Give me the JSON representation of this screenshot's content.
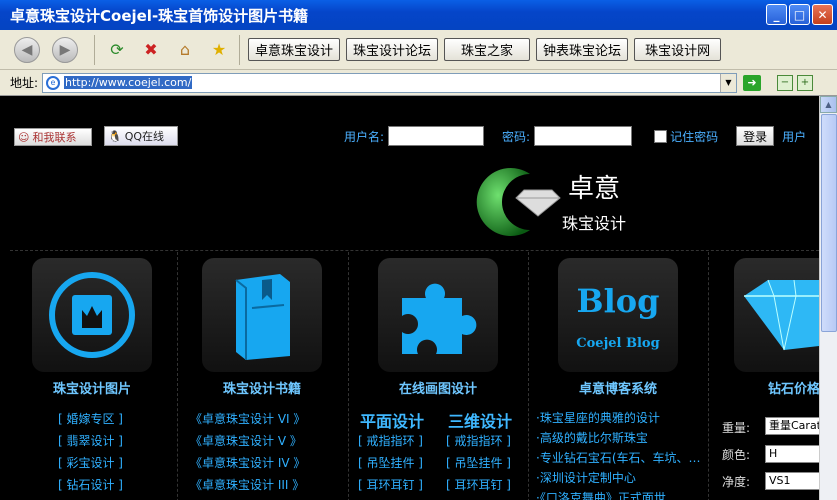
{
  "window": {
    "title": "卓意珠宝设计Coejel-珠宝首饰设计图片书籍"
  },
  "toolbar": {
    "links": [
      "卓意珠宝设计",
      "珠宝设计论坛",
      "珠宝之家",
      "钟表珠宝论坛",
      "珠宝设计网"
    ]
  },
  "address": {
    "label": "地址:",
    "url": "http://www.coejel.com/"
  },
  "header": {
    "contact_label": "和我联系",
    "qq_label": "QQ在线",
    "username_label": "用户名:",
    "password_label": "密码:",
    "remember_label": "记住密码",
    "login_label": "登录",
    "user_label": "用户"
  },
  "logo": {
    "name": "卓意",
    "subtitle": "珠宝设计"
  },
  "columns": {
    "c1": {
      "title": "珠宝设计图片",
      "items": [
        "[ 婚嫁专区 ]",
        "[ 翡翠设计 ]",
        "[ 彩宝设计 ]",
        "[ 钻石设计 ]"
      ]
    },
    "c2": {
      "title": "珠宝设计书籍",
      "items": [
        "《卓意珠宝设计 VI 》",
        "《卓意珠宝设计 V 》",
        "《卓意珠宝设计 IV 》",
        "《卓意珠宝设计 III 》"
      ]
    },
    "c3": {
      "title": "在线画图设计",
      "h1": "平面设计",
      "h2": "三维设计",
      "left": [
        "[ 戒指指环 ]",
        "[ 吊坠挂件 ]",
        "[ 耳环耳钉 ]"
      ],
      "right": [
        "[ 戒指指环 ]",
        "[ 吊坠挂件 ]",
        "[ 耳环耳钉 ]"
      ]
    },
    "c4": {
      "title": "卓意博客系统",
      "blog_big": "Blog",
      "blog_small": "Coejel Blog",
      "items": [
        "·珠宝星座的典雅的设计",
        "·高级的戴比尔斯珠宝",
        "·专业钻石宝石(车石、车坑、…",
        "·深圳设计定制中心",
        "·《口洛克舞曲》正式面世"
      ]
    },
    "c5": {
      "title": "钻石价格",
      "fields": [
        {
          "label": "重量:",
          "value": "重量Carat"
        },
        {
          "label": "颜色:",
          "value": "H"
        },
        {
          "label": "净度:",
          "value": "VS1"
        }
      ]
    }
  },
  "colors": {
    "accent": "#2fb0ff",
    "tile_icon": "#17a7f0"
  }
}
